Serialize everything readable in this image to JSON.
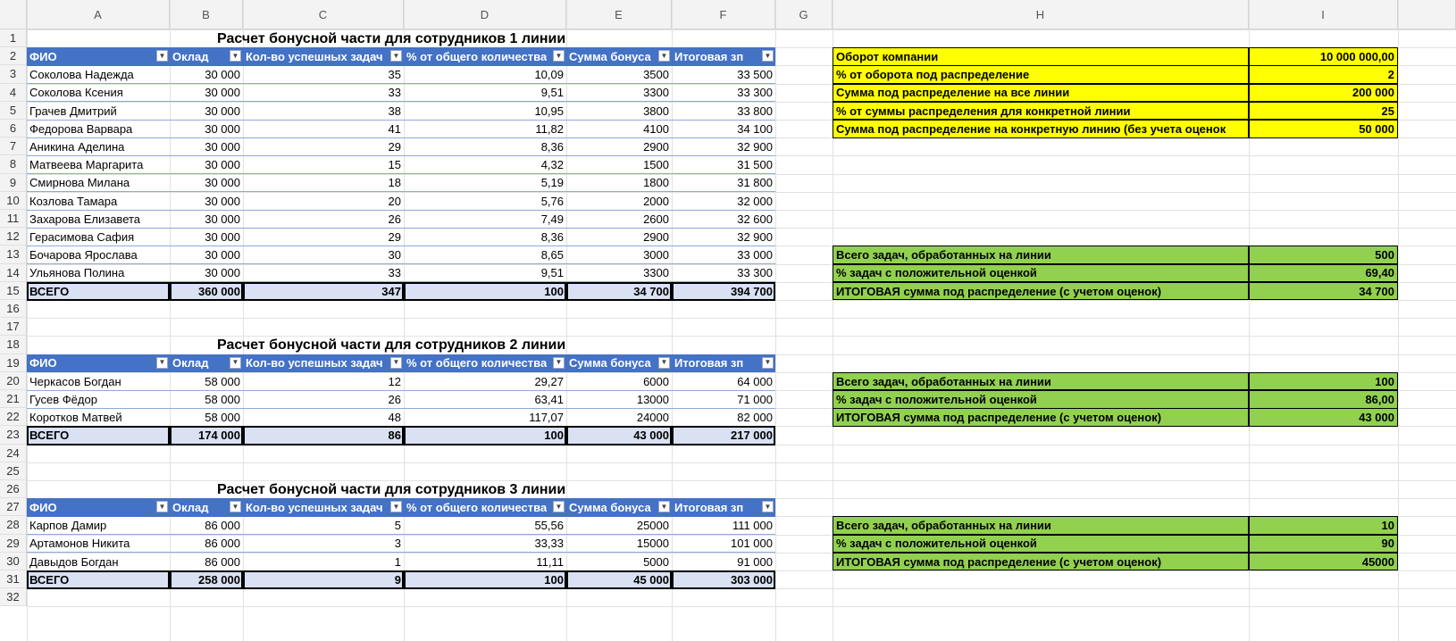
{
  "columns": [
    "A",
    "B",
    "C",
    "D",
    "E",
    "F",
    "G",
    "H",
    "I"
  ],
  "rows": [
    "1",
    "2",
    "3",
    "4",
    "5",
    "6",
    "7",
    "8",
    "9",
    "10",
    "11",
    "12",
    "13",
    "14",
    "15",
    "16",
    "17",
    "18",
    "19",
    "20",
    "21",
    "22",
    "23",
    "24",
    "25",
    "26",
    "27",
    "28",
    "29",
    "30",
    "31",
    "32"
  ],
  "headers": [
    "ФИО",
    "Оклад",
    "Кол-во успешных задач",
    "% от общего количества",
    "Сумма бонуса",
    "Итоговая зп"
  ],
  "tables": [
    {
      "title": "Расчет бонусной части для сотрудников 1 линии",
      "rows": [
        [
          "Соколова Надежда",
          "30 000",
          "35",
          "10,09",
          "3500",
          "33 500"
        ],
        [
          "Соколова Ксения",
          "30 000",
          "33",
          "9,51",
          "3300",
          "33 300"
        ],
        [
          "Грачев Дмитрий",
          "30 000",
          "38",
          "10,95",
          "3800",
          "33 800"
        ],
        [
          "Федорова Варвара",
          "30 000",
          "41",
          "11,82",
          "4100",
          "34 100"
        ],
        [
          "Аникина Аделина",
          "30 000",
          "29",
          "8,36",
          "2900",
          "32 900"
        ],
        [
          "Матвеева Маргарита",
          "30 000",
          "15",
          "4,32",
          "1500",
          "31 500"
        ],
        [
          "Смирнова Милана",
          "30 000",
          "18",
          "5,19",
          "1800",
          "31 800"
        ],
        [
          "Козлова Тамара",
          "30 000",
          "20",
          "5,76",
          "2000",
          "32 000"
        ],
        [
          "Захарова Елизавета",
          "30 000",
          "26",
          "7,49",
          "2600",
          "32 600"
        ],
        [
          "Герасимова Сафия",
          "30 000",
          "29",
          "8,36",
          "2900",
          "32 900"
        ],
        [
          "Бочарова Ярослава",
          "30 000",
          "30",
          "8,65",
          "3000",
          "33 000"
        ],
        [
          "Ульянова Полина",
          "30 000",
          "33",
          "9,51",
          "3300",
          "33 300"
        ]
      ],
      "total": [
        "ВСЕГО",
        "360 000",
        "347",
        "100",
        "34 700",
        "394 700"
      ]
    },
    {
      "title": "Расчет бонусной части для сотрудников 2 линии",
      "rows": [
        [
          "Черкасов Богдан",
          "58 000",
          "12",
          "29,27",
          "6000",
          "64 000"
        ],
        [
          "Гусев Фёдор",
          "58 000",
          "26",
          "63,41",
          "13000",
          "71 000"
        ],
        [
          "Коротков Матвей",
          "58 000",
          "48",
          "117,07",
          "24000",
          "82 000"
        ]
      ],
      "total": [
        "ВСЕГО",
        "174 000",
        "86",
        "100",
        "43 000",
        "217 000"
      ]
    },
    {
      "title": "Расчет бонусной части для сотрудников 3 линии",
      "rows": [
        [
          "Карпов Дамир",
          "86 000",
          "5",
          "55,56",
          "25000",
          "111 000"
        ],
        [
          "Артамонов Никита",
          "86 000",
          "3",
          "33,33",
          "15000",
          "101 000"
        ],
        [
          "Давыдов Богдан",
          "86 000",
          "1",
          "11,11",
          "5000",
          "91 000"
        ]
      ],
      "total": [
        "ВСЕГО",
        "258 000",
        "9",
        "100",
        "45 000",
        "303 000"
      ]
    }
  ],
  "summary": [
    {
      "label": "Оборот компании",
      "value": "10 000 000,00"
    },
    {
      "label": "% от оборота под распределение",
      "value": "2"
    },
    {
      "label": "Сумма под распределение на все линии",
      "value": "200 000"
    },
    {
      "label": "% от суммы распределения для конкретной линии",
      "value": "25"
    },
    {
      "label": "Сумма под распределение на конкретную линию (без учета оценок",
      "value": "50 000"
    }
  ],
  "line_stats": [
    [
      {
        "label": "Всего задач, обработанных на линии",
        "value": "500"
      },
      {
        "label": "% задач с положительной оценкой",
        "value": "69,40"
      },
      {
        "label": "ИТОГОВАЯ сумма под распределение (с учетом оценок)",
        "value": "34 700"
      }
    ],
    [
      {
        "label": "Всего задач, обработанных на линии",
        "value": "100"
      },
      {
        "label": "% задач с положительной оценкой",
        "value": "86,00"
      },
      {
        "label": "ИТОГОВАЯ сумма под распределение (с учетом оценок)",
        "value": "43 000"
      }
    ],
    [
      {
        "label": "Всего задач, обработанных на линии",
        "value": "10"
      },
      {
        "label": "% задач с положительной оценкой",
        "value": "90"
      },
      {
        "label": "ИТОГОВАЯ сумма под распределение (с учетом оценок)",
        "value": "45000"
      }
    ]
  ],
  "colors": {
    "table_header": "#4472c4",
    "total_row": "#d9e1f2",
    "summary_fill": "#ffff00",
    "stats_fill": "#92d050"
  }
}
